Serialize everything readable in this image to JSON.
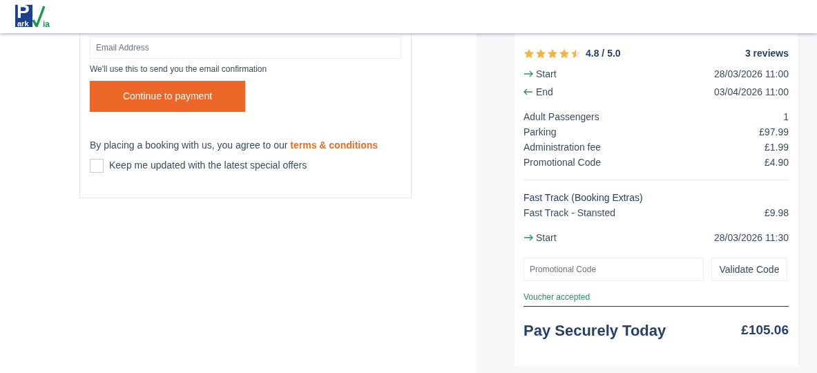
{
  "header": {
    "logo": {
      "letter": "P",
      "word": "ark",
      "suffix": "ia"
    }
  },
  "contact_form": {
    "email": {
      "placeholder": "Email Address"
    },
    "email_hint": "We'll use this to send you the email confirmation",
    "continue_button": "Continue to payment",
    "agreement": "By placing a booking with us, you agree to our",
    "terms_link": "terms & conditions",
    "offers_checkbox": {
      "label": "Keep me updated with the latest special offers",
      "checked": false
    }
  },
  "summary": {
    "rating": {
      "stars": 4.5,
      "score": "4.8 / 5.0",
      "reviews": "3 reviews"
    },
    "dates": [
      {
        "kind": "start",
        "label": "Start",
        "value": "28/03/2026 11:00"
      },
      {
        "kind": "end",
        "label": "End",
        "value": "03/04/2026 11:00"
      }
    ],
    "charges": [
      {
        "label": "Adult Passengers",
        "value": "1"
      },
      {
        "label": "Parking",
        "value": "£97.99"
      },
      {
        "label": "Administration fee",
        "value": "£1.99"
      },
      {
        "label": "Promotional Code",
        "value": "£4.90"
      }
    ],
    "extras": {
      "title": "Fast Track (Booking Extras)",
      "items": [
        {
          "label": "Fast Track - Stansted",
          "value": "£9.98"
        }
      ],
      "dates": [
        {
          "kind": "start",
          "label": "Start",
          "value": "28/03/2026 11:30"
        }
      ]
    },
    "promo": {
      "placeholder": "Promotional Code",
      "button": "Validate Code",
      "message": "Voucher accepted"
    },
    "total": {
      "label": "Pay Securely Today",
      "value": "£105.06"
    }
  }
}
